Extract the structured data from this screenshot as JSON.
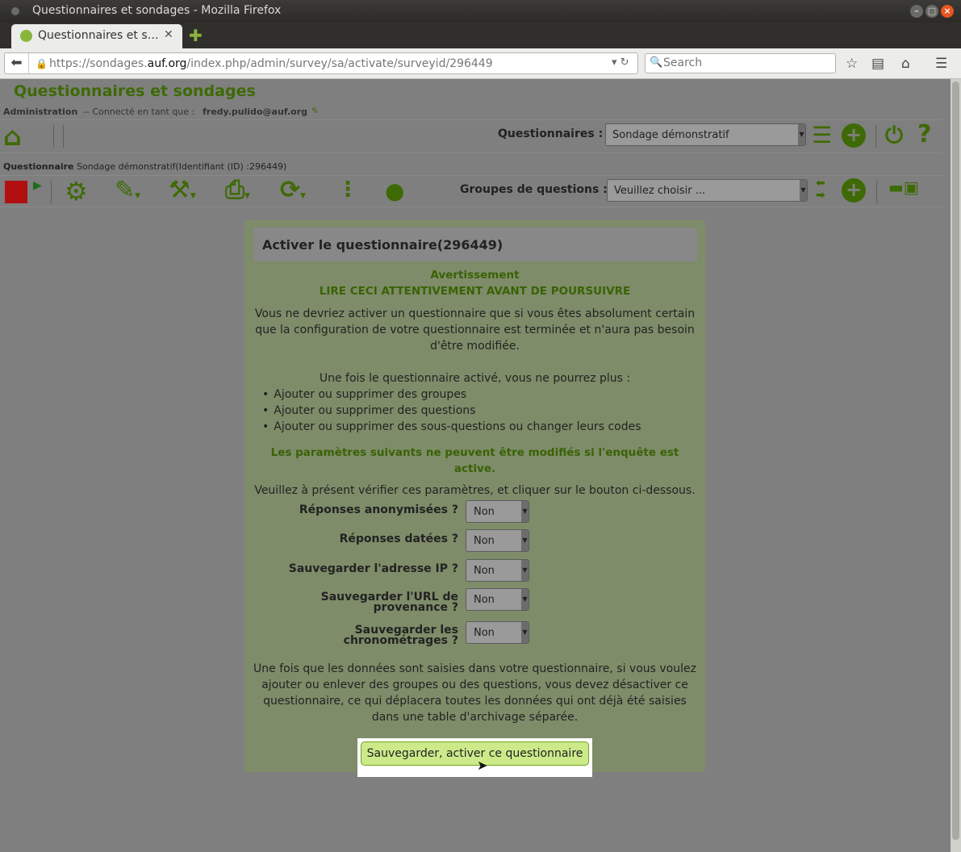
{
  "window": {
    "title": "Questionnaires et sondages - Mozilla Firefox"
  },
  "tab": {
    "title": "Questionnaires et s…"
  },
  "address_bar": {
    "url_prefix": "https://sondages.",
    "url_domain": "auf.org",
    "url_path": "/index.php/admin/survey/sa/activate/surveyid/296449"
  },
  "search": {
    "placeholder": "Search"
  },
  "app": {
    "title": "Questionnaires et sondages"
  },
  "admin_bar": {
    "admin_label": "Administration",
    "connected_text": "-- Connecté en tant que :",
    "user": "fredy.pulido@auf.org"
  },
  "toolbar1": {
    "surveys_label": "Questionnaires :",
    "survey_select_value": "Sondage démonstratif"
  },
  "survey_bar": {
    "label": "Questionnaire",
    "text": "Sondage démonstratif(Identifiant (ID) :296449)"
  },
  "toolbar2": {
    "groups_label": "Groupes de questions :",
    "groups_select_value": "Veuillez choisir ..."
  },
  "panel": {
    "title": "Activer le questionnaire(296449)",
    "warning_title": "Avertissement",
    "warning_subtitle": "LIRE CECI ATTENTIVEMENT AVANT DE POURSUIVRE",
    "intro": "Vous ne devriez activer un questionnaire que si vous êtes absolument certain que la configuration de votre questionnaire est terminée et n'aura pas besoin d'être modifiée.",
    "once_active": "Une fois le questionnaire activé, vous ne pourrez plus :",
    "bullets": [
      "Ajouter ou supprimer des groupes",
      "Ajouter ou supprimer des questions",
      "Ajouter ou supprimer des sous-questions ou changer leurs codes"
    ],
    "params_warning": "Les paramètres suivants ne peuvent être modifiés si l'enquête est active.",
    "check_text": "Veuillez à présent vérifier ces paramètres, et cliquer sur le bouton ci-dessous.",
    "settings": [
      {
        "label": "Réponses anonymisées ?",
        "value": "Non"
      },
      {
        "label": "Réponses datées ?",
        "value": "Non"
      },
      {
        "label": "Sauvegarder l'adresse IP ?",
        "value": "Non"
      },
      {
        "label": "Sauvegarder l'URL de provenance ?",
        "value": "Non"
      },
      {
        "label": "Sauvegarder les chronométrages ?",
        "value": "Non"
      }
    ],
    "footer": "Une fois que les données sont saisies dans votre questionnaire, si vous voulez ajouter ou enlever des groupes ou des questions, vous devez désactiver ce questionnaire, ce qui déplacera toutes les données qui ont déjà été saisies dans une table d'archivage séparée.",
    "activate_button": "Sauvegarder, activer ce questionnaire"
  }
}
